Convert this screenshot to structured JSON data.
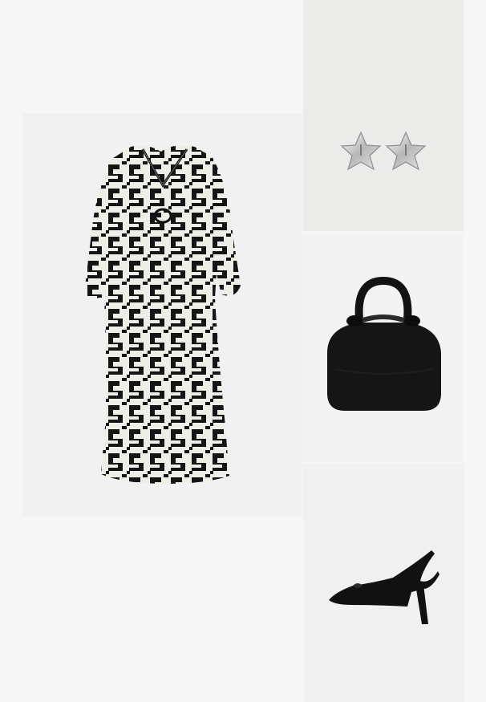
{
  "outfit": {
    "items": [
      {
        "id": "dress",
        "icon": "dress-icon",
        "color": "#1a1a1a",
        "pattern": "geometric-black-cream"
      },
      {
        "id": "earrings",
        "icon": "star-earrings-icon",
        "color": "#c9c9c9"
      },
      {
        "id": "bag",
        "icon": "handbag-icon",
        "color": "#111111"
      },
      {
        "id": "shoe",
        "icon": "slingback-pump-icon",
        "color": "#111111"
      }
    ]
  }
}
